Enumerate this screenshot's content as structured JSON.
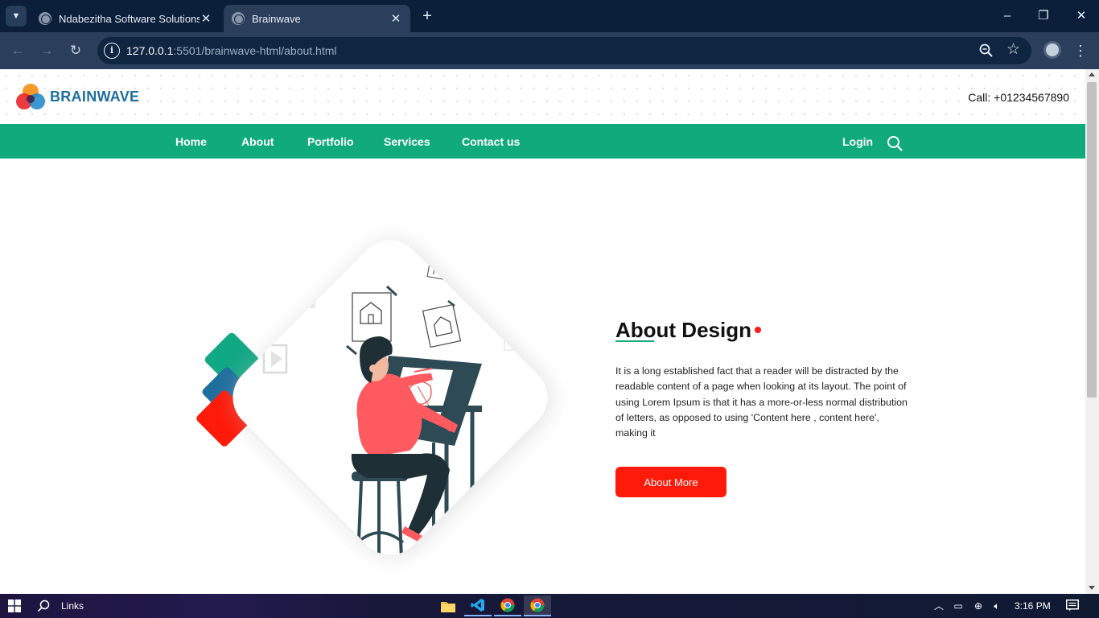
{
  "browser": {
    "tabs": [
      {
        "title": "Ndabezitha Software Solutions",
        "active": false
      },
      {
        "title": "Brainwave",
        "active": true
      }
    ],
    "url": {
      "host": "127.0.0.1",
      "rest": ":5501/brainwave-html/about.html"
    },
    "window_controls": {
      "minimize": "–",
      "restore": "❐",
      "close": "✕"
    }
  },
  "site": {
    "logo_text": "BRAINWAVE",
    "call": "Call: +01234567890",
    "nav": [
      {
        "label": "Home"
      },
      {
        "label": "About"
      },
      {
        "label": "Portfolio"
      },
      {
        "label": "Services"
      },
      {
        "label": "Contact us"
      }
    ],
    "login": "Login"
  },
  "about": {
    "title": "About Design",
    "text": "It is a long established fact that a reader will be distracted by the readable content of a page when looking at its layout. The point of using Lorem Ipsum is that it has a more-or-less normal distribution of letters, as opposed to using 'Content here , content here', making it",
    "button": "About More"
  },
  "taskbar": {
    "search_label": "Links",
    "clock": "3:16 PM"
  },
  "colors": {
    "nav_green": "#11aa7d",
    "accent_red": "#ff1a0a",
    "logo_blue": "#1f6f9e",
    "tab_bar": "#0b1f3a",
    "toolbar": "#2b3f5c"
  }
}
